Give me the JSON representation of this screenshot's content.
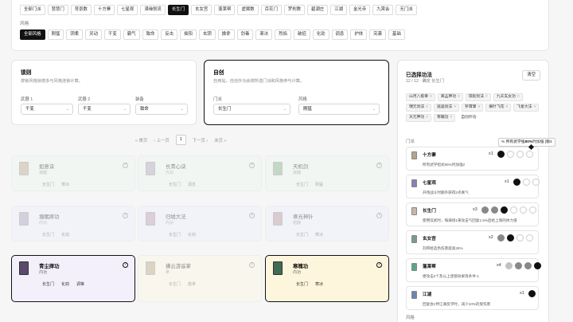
{
  "sect_row": [
    "全部门派",
    "慧慧门",
    "育景数",
    "十方寨",
    "七星观",
    "漠缘刨流",
    "长生门",
    "玄女宫",
    "蓬莱帮",
    "虚翼数",
    "百花门",
    "罗刹教",
    "碧潮庄",
    "江湖",
    "金光寺",
    "九霄会",
    "无门派"
  ],
  "sect_active": 6,
  "style_label": "风格",
  "style_row": [
    "全部风格",
    "刚猛",
    "阴柔",
    "灵动",
    "干变",
    "霸气",
    "致命",
    "反击",
    "拙阳",
    "玄阴",
    "擒拿",
    "剑毒",
    "寒冰",
    "烈焰",
    "破招",
    "化劲",
    "调息",
    "护体",
    "突袭",
    "基础"
  ],
  "style_active": 0,
  "mode_left": {
    "title": "锁则",
    "desc": "按锁风格锁按多与风格连锁计算。",
    "field1_label": "武器 1",
    "field1_value": "千变",
    "field2_label": "武器 2",
    "field2_value": "千变",
    "field3_label": "装备",
    "field3_value": "致命"
  },
  "mode_right": {
    "title": "自创",
    "desc": "自用站，自创外功会按所选门派和风格参与计算。",
    "sect_label": "门派",
    "sect_value": "长生门",
    "style_label": "风格",
    "style_value": "刚猛"
  },
  "pager": {
    "first": "« 首页",
    "prev": "‹ 上一页",
    "page": "1",
    "next": "下一页 ›",
    "last": "末页 »"
  },
  "cards": [
    {
      "name": "如意诀",
      "sub": "狼器",
      "tags": [
        "长生门",
        "寒冰"
      ]
    },
    {
      "name": "长青心诀",
      "sub": "内功",
      "tags": [
        "长生门",
        "调息"
      ]
    },
    {
      "name": "天机剑",
      "sub": "狼器",
      "tags": [
        "长生门",
        "刚猛"
      ]
    },
    {
      "name": "塘眠摔功",
      "sub": "内功",
      "tags": [
        "长生门",
        "化劲"
      ]
    },
    {
      "name": "归墟大法",
      "sub": "内功",
      "tags": [
        "长生门",
        "化劲"
      ]
    },
    {
      "name": "寒光神针",
      "sub": "暗器",
      "tags": [
        "长生门",
        "寒冰"
      ]
    },
    {
      "name": "青尘摔功",
      "sub": "内功",
      "tags": [
        "长生门",
        "化劲",
        "调等"
      ]
    },
    {
      "name": "拂云游遥掌",
      "sub": "拳",
      "tags": [
        "长生门",
        "擒拿"
      ]
    },
    {
      "name": "寒魄功",
      "sub": "内功",
      "tags": [
        "长生门",
        "寒冰"
      ]
    }
  ],
  "right": {
    "header": "已选择功法",
    "count": "12 / 12 · 确定 长生门",
    "clear": "清空",
    "chips": [
      "山河八极拳",
      "离孟神功",
      "琼舵剑法",
      "九天玄女功",
      "瑞元剑法",
      "逍遥剑法",
      "罗霄掌",
      "摘叶飞花",
      "飞星大法",
      "天元神功",
      "寒魄功",
      "自创外功"
    ],
    "sect_label": "门派",
    "style_label": "风格",
    "tooltip_pre": "% 所有武学强",
    "tooltip_bold": "80%",
    "tooltip_post": "时加强 [额4",
    "sects": [
      {
        "name": "十方寨",
        "count": "x1",
        "desc": "所有武学招式65%时加强2"
      },
      {
        "name": "七星观",
        "count": "x1",
        "desc": "开场战斗时额外获得2点真气"
      },
      {
        "name": "长生门",
        "count": "x3",
        "desc": "使用双武时，每满场1来攻击气回复1.5%后给上限的体力值"
      },
      {
        "name": "玄女宫",
        "count": "x2",
        "desc": "刘邦给选色伤害提高25%"
      },
      {
        "name": "蓬莱帮",
        "count": "x4",
        "desc": "便攻击2个及以上连锁效果等条件-1"
      },
      {
        "name": "江湖",
        "count": "x1",
        "desc": "回复会1伸江湖反学时，减少10%的受伤害"
      }
    ]
  }
}
